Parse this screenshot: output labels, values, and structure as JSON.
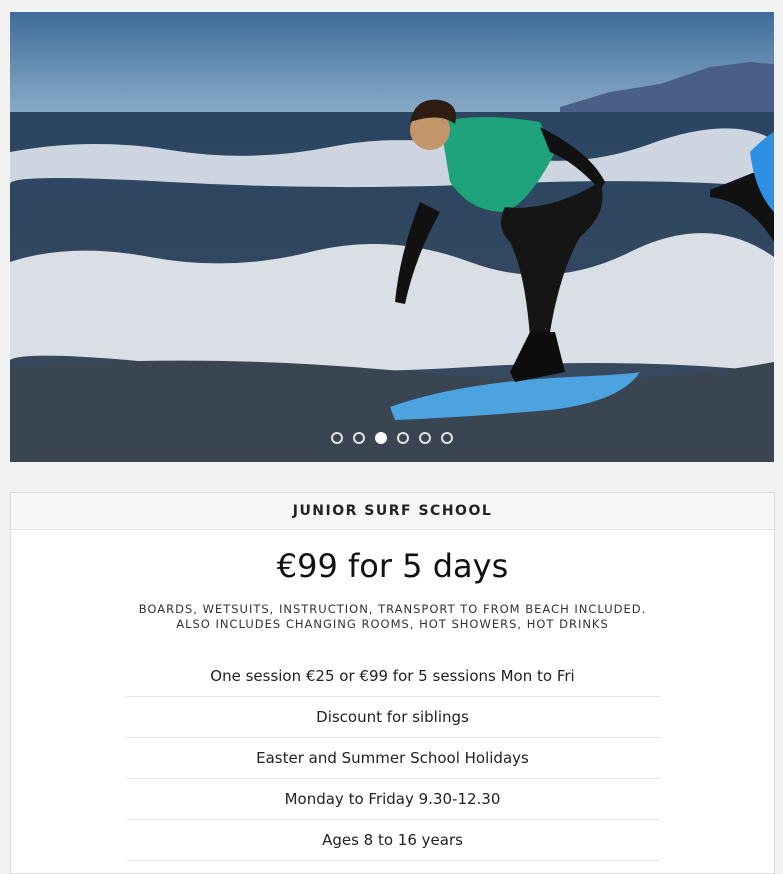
{
  "hero": {
    "image_alt": "Junior surfer riding a blue surfboard on a wave",
    "slides": [
      {
        "label": "Slide 1",
        "active": false
      },
      {
        "label": "Slide 2",
        "active": false
      },
      {
        "label": "Slide 3",
        "active": true
      },
      {
        "label": "Slide 4",
        "active": false
      },
      {
        "label": "Slide 5",
        "active": false
      },
      {
        "label": "Slide 6",
        "active": false
      }
    ]
  },
  "card": {
    "title": "JUNIOR SURF SCHOOL",
    "price": "€99 for 5 days",
    "includes_line1": "BOARDS, WETSUITS, INSTRUCTION, TRANSPORT TO FROM BEACH INCLUDED.",
    "includes_line2": "ALSO INCLUDES CHANGING ROOMS, HOT SHOWERS, HOT DRINKS",
    "features": [
      "One session €25 or €99 for 5 sessions Mon to Fri",
      "Discount for siblings",
      "Easter and Summer School Holidays",
      "Monday to Friday 9.30-12.30",
      "Ages 8 to 16 years"
    ]
  },
  "colors": {
    "background": "#f2f2f2",
    "card_header_bg": "#f7f7f7",
    "surfboard": "#4da3e0",
    "rash_vest": "#1fa37a"
  }
}
